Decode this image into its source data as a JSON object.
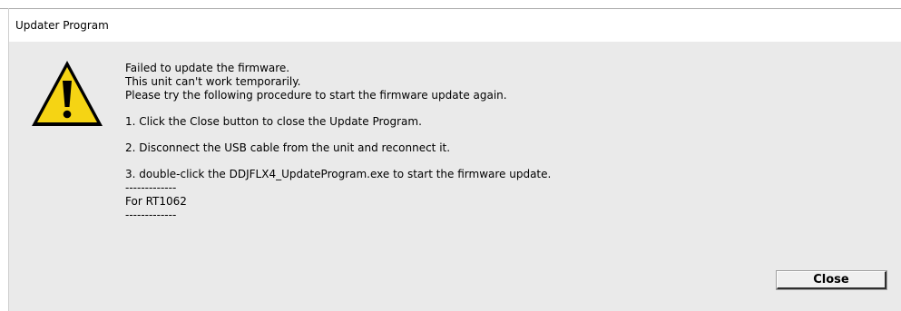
{
  "window": {
    "title": "Updater Program"
  },
  "dialog": {
    "icon": "warning-triangle-icon",
    "icon_colors": {
      "fill": "#f5d414",
      "border": "#000000",
      "mark": "#000000"
    },
    "lines": [
      "Failed to update the firmware.",
      "This unit can't work temporarily.",
      "Please try the following procedure to start the firmware update again."
    ],
    "steps": [
      "1. Click the Close button to close the Update Program.",
      "2. Disconnect the USB cable from the unit and reconnect it.",
      "3. double-click the DDJFLX4_UpdateProgram.exe to start the firmware update."
    ],
    "separator_top": "-------------",
    "chip_label": "For RT1062",
    "separator_bottom": "-------------"
  },
  "buttons": {
    "close_label": "Close"
  }
}
